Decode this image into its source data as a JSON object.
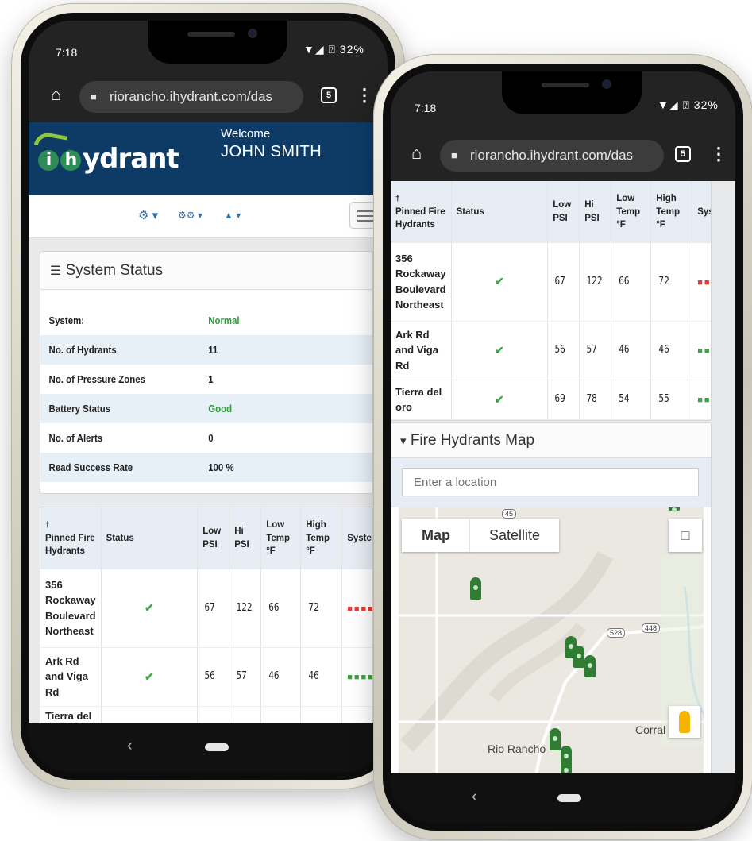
{
  "status_bar": {
    "left_time": "7:18",
    "left_battery": "▼◢ ⍰ 32%",
    "right_time": "7:18",
    "right_battery": "▼◢ ⍰ 32%"
  },
  "browser": {
    "left_url": "riorancho.ihydrant.com/das",
    "right_url": "riorancho.ihydrant.com/das",
    "tab_count": "5"
  },
  "header": {
    "logo_text": "ydrant",
    "welcome_label": "Welcome",
    "user_name": "JOHN SMITH"
  },
  "toolbar": {
    "settings_menu": "⚙ ▾",
    "admin_menu": "⚙⚙ ▾",
    "user_menu": "👤 ▾"
  },
  "system_status": {
    "title": "System Status",
    "rows": [
      {
        "label": "System:",
        "value": "Normal"
      },
      {
        "label": "No. of Hydrants",
        "value": "11"
      },
      {
        "label": "No. of Pressure Zones",
        "value": "1"
      },
      {
        "label": "Battery Status",
        "value": "Good"
      },
      {
        "label": "No. of Alerts",
        "value": "0"
      },
      {
        "label": "Read Success Rate",
        "value": "100 %"
      }
    ],
    "colors": {
      "ok": "#2e9e3b"
    }
  },
  "pinned_table": {
    "headers": [
      "Pinned Fire Hydrants",
      "Status",
      "Low PSI",
      "Hi PSI",
      "Low Temp °F",
      "High Temp °F",
      "System Pe"
    ],
    "right_headers": [
      "Pinned Fire Hydrants",
      "Status",
      "Low PSI",
      "Hi PSI",
      "Low Temp °F",
      "High Temp °F",
      "System Pe"
    ],
    "rows": [
      {
        "name": "356 Rockaway Boulevard Northeast",
        "status": "✔",
        "low_psi": "67",
        "hi_psi": "122",
        "low_temp": "66",
        "high_temp": "72",
        "perf_color": "#e53935"
      },
      {
        "name": "Ark Rd and Viga Rd",
        "status": "✔",
        "low_psi": "56",
        "hi_psi": "57",
        "low_temp": "46",
        "high_temp": "46",
        "perf_color": "#43a047"
      },
      {
        "name": "Tierra del oro",
        "status": "✔",
        "low_psi": "69",
        "hi_psi": "78",
        "low_temp": "54",
        "high_temp": "55",
        "perf_color": "#43a047"
      }
    ],
    "left_partial_name": "Tierra del"
  },
  "map_panel": {
    "title": "Fire Hydrants Map",
    "search_placeholder": "Enter a location",
    "map_button": "Map",
    "satellite_button": "Satellite",
    "labels": {
      "city": "Rio Rancho",
      "corrales": "Corral",
      "road_528": "528",
      "road_448": "448",
      "road_top": "45"
    }
  },
  "icons": {
    "home": "⌂",
    "lock": "🔒",
    "menu": "⋮",
    "back": "‹",
    "pin": "📌",
    "list": "☰",
    "location": "⚲",
    "fullscreen": "⛶",
    "pegman": "🚶"
  }
}
